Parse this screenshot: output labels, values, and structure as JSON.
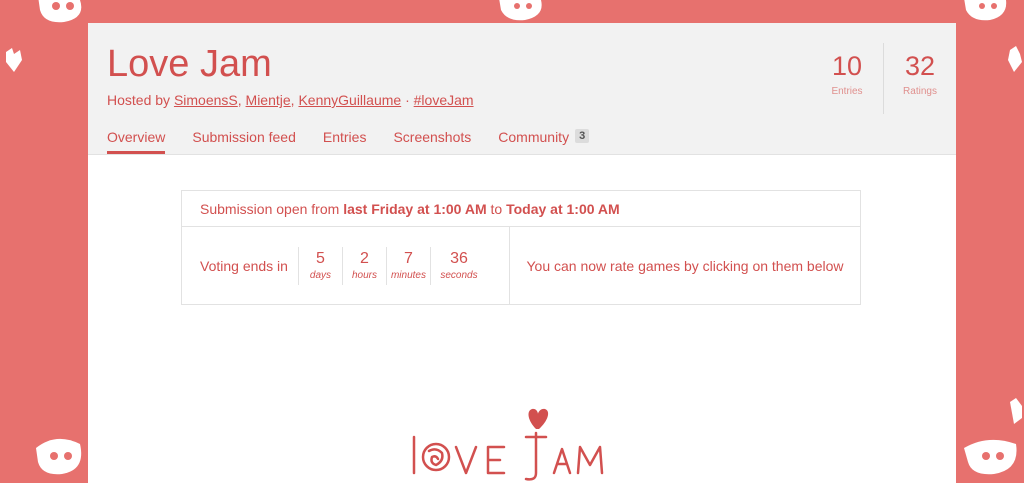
{
  "jam": {
    "title": "Love Jam",
    "hosted_prefix": "Hosted by",
    "hosts": [
      "SimoensS",
      "Mientje",
      "KennyGuillaume"
    ],
    "hashtag": "#loveJam"
  },
  "stats": [
    {
      "value": "10",
      "label": "Entries"
    },
    {
      "value": "32",
      "label": "Ratings"
    }
  ],
  "tabs": [
    {
      "label": "Overview",
      "active": true
    },
    {
      "label": "Submission feed"
    },
    {
      "label": "Entries"
    },
    {
      "label": "Screenshots"
    },
    {
      "label": "Community",
      "badge": "3"
    }
  ],
  "submission": {
    "prefix": "Submission open from",
    "start": "last Friday at 1:00 AM",
    "to": "to",
    "end": "Today at 1:00 AM"
  },
  "voting": {
    "label": "Voting ends in",
    "days": {
      "value": "5",
      "label": "days"
    },
    "hours": {
      "value": "2",
      "label": "hours"
    },
    "minutes": {
      "value": "7",
      "label": "minutes"
    },
    "seconds": {
      "value": "36",
      "label": "seconds"
    },
    "message": "You can now rate games by clicking on them below"
  },
  "logo_text": "Love Jam",
  "colors": {
    "background": "#e7716e",
    "accent": "#d2504f"
  }
}
